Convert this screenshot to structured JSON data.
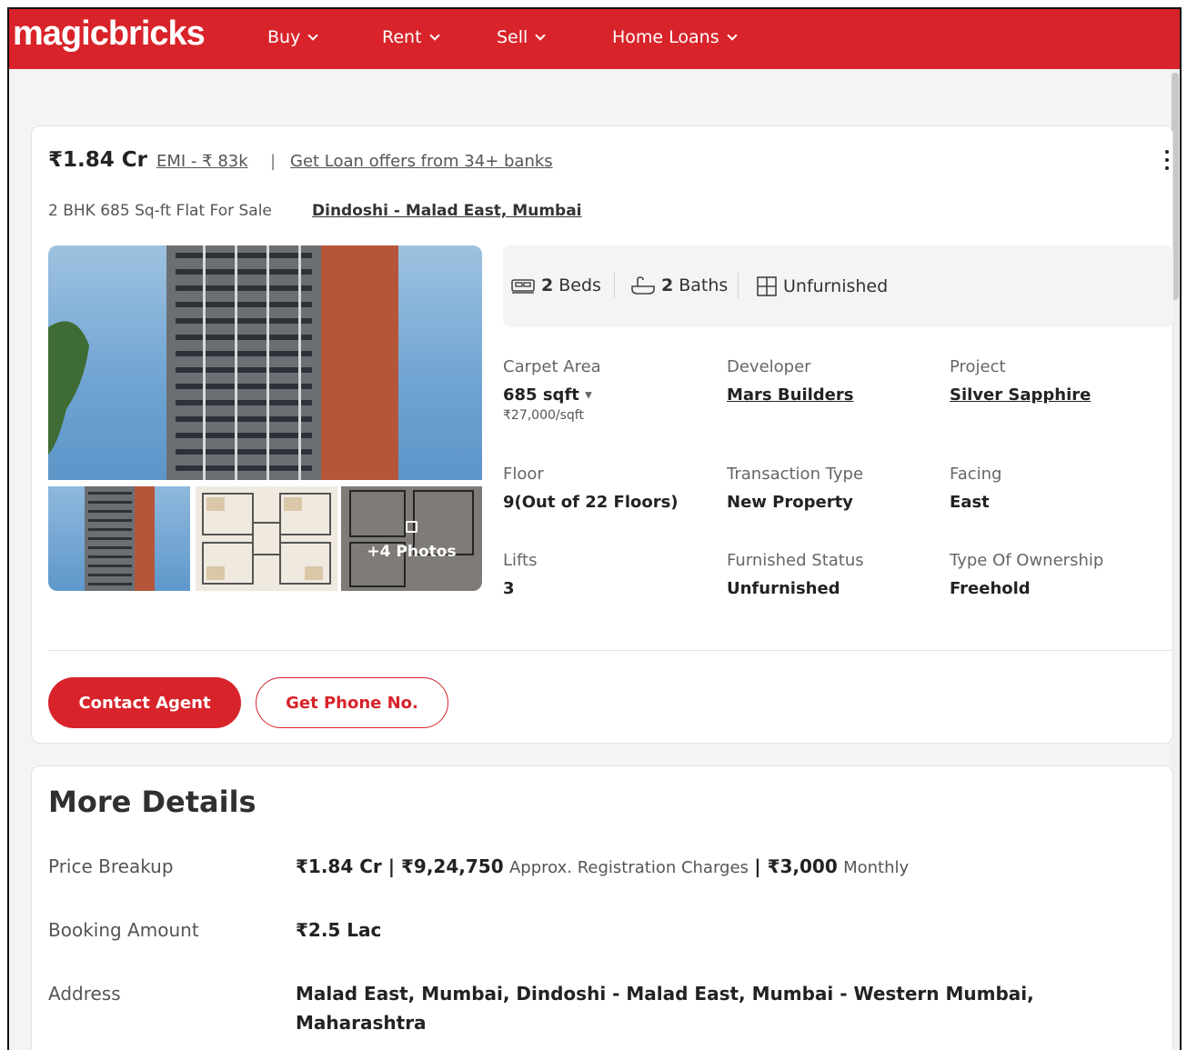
{
  "header": {
    "logo": "magicbricks",
    "nav": [
      {
        "label": "Buy"
      },
      {
        "label": "Rent"
      },
      {
        "label": "Sell"
      },
      {
        "label": "Home Loans"
      }
    ]
  },
  "listing": {
    "price": "₹1.84 Cr",
    "emi": "EMI - ₹ 83k",
    "separator": "|",
    "loan_offer": "Get Loan offers from 34+ banks",
    "subtitle": "2 BHK 685 Sq-ft Flat For Sale",
    "location_link": "Dindoshi - Malad East, Mumbai",
    "photos_label": "+4 Photos",
    "amenities": {
      "beds_count": "2",
      "beds_label": "Beds",
      "baths_count": "2",
      "baths_label": "Baths",
      "furnishing": "Unfurnished"
    },
    "specs": {
      "carpet_area_label": "Carpet Area",
      "carpet_area_value": "685 sqft",
      "carpet_area_rate": "₹27,000/sqft",
      "developer_label": "Developer",
      "developer_value": "Mars Builders",
      "project_label": "Project",
      "project_value": "Silver Sapphire",
      "floor_label": "Floor",
      "floor_value": "9(Out of 22 Floors)",
      "transaction_label": "Transaction Type",
      "transaction_value": "New Property",
      "facing_label": "Facing",
      "facing_value": "East",
      "lifts_label": "Lifts",
      "lifts_value": "3",
      "furnished_label": "Furnished Status",
      "furnished_value": "Unfurnished",
      "ownership_label": "Type Of Ownership",
      "ownership_value": "Freehold"
    },
    "buttons": {
      "contact": "Contact Agent",
      "phone": "Get Phone No."
    }
  },
  "more_details": {
    "title": "More Details",
    "price_breakup_label": "Price Breakup",
    "price_main": "₹1.84 Cr | ₹9,24,750",
    "price_reg_text": "Approx. Registration Charges",
    "price_maint": "| ₹3,000",
    "price_monthly": "Monthly",
    "booking_label": "Booking Amount",
    "booking_value": "₹2.5 Lac",
    "address_label": "Address",
    "address_value": "Malad East, Mumbai, Dindoshi - Malad East, Mumbai - Western Mumbai, Maharashtra"
  },
  "colors": {
    "brand_red": "#d8232a"
  }
}
